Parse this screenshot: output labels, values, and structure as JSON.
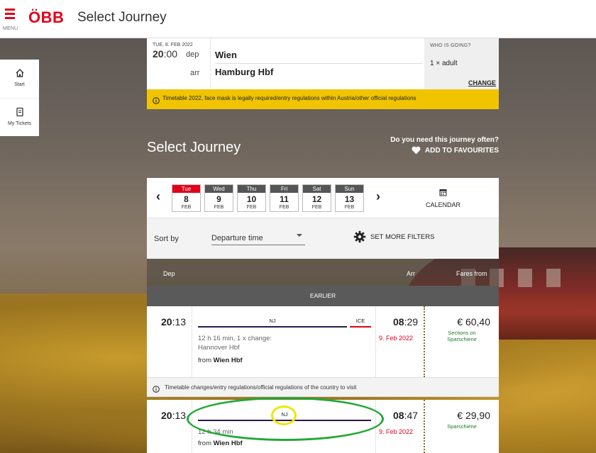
{
  "header": {
    "menu_label": "MENU",
    "logo": "ÖBB",
    "title": "Select Journey"
  },
  "sidenav": {
    "items": [
      {
        "label": "Start",
        "icon": "home-icon"
      },
      {
        "label": "My Tickets",
        "icon": "ticket-icon"
      }
    ]
  },
  "summary": {
    "date": "TUE, 8. FEB 2022",
    "time_hours": "20",
    "time_minutes": ":00",
    "dep_label": "dep",
    "arr_label": "arr",
    "from": "Wien",
    "to": "Hamburg Hbf",
    "who_label": "WHO IS GOING?",
    "who_value": "1 × adult",
    "change_label": "CHANGE"
  },
  "notice_top": "Timetable 2022, face mask is legally required/entry regulations within Austria/other official regulations",
  "page_heading": "Select Journey",
  "favourites": {
    "question": "Do you need this journey often?",
    "action": "ADD TO FAVOURITES"
  },
  "datebar": {
    "prev": "‹",
    "next": "›",
    "days": [
      {
        "name": "Tue",
        "day": "8",
        "month": "FEB",
        "selected": true
      },
      {
        "name": "Wed",
        "day": "9",
        "month": "FEB",
        "selected": false
      },
      {
        "name": "Thu",
        "day": "10",
        "month": "FEB",
        "selected": false
      },
      {
        "name": "Fri",
        "day": "11",
        "month": "FEB",
        "selected": false
      },
      {
        "name": "Sat",
        "day": "12",
        "month": "FEB",
        "selected": false
      },
      {
        "name": "Sun",
        "day": "13",
        "month": "FEB",
        "selected": false
      }
    ],
    "calendar_label": "CALENDAR"
  },
  "sort": {
    "label": "Sort by",
    "value": "Departure time",
    "filters_label": "SET MORE FILTERS"
  },
  "results": {
    "col_dep": "Dep",
    "col_arr": "Arr",
    "col_fares": "Fares from",
    "earlier_label": "EARLIER",
    "connections": [
      {
        "dep_hours": "20",
        "dep_minutes": ":13",
        "train1": "NJ",
        "train2": "ICE",
        "info_line1": "12 h 16 min, 1 x change:",
        "info_line2": "Hannover Hbf",
        "from_prefix": "from",
        "from_station": "Wien Hbf",
        "arr_hours": "08",
        "arr_minutes": ":29",
        "arr_date": "9. Feb 2022",
        "fare": "€ 60,40",
        "fare_note": "Sections on Sparschiene"
      },
      {
        "dep_hours": "20",
        "dep_minutes": ":13",
        "train1": "NJ",
        "info_line1": "12 h 34 min",
        "from_prefix": "from",
        "from_station": "Wien Hbf",
        "arr_hours": "08",
        "arr_minutes": ":47",
        "arr_date": "9. Feb 2022",
        "fare": "€ 29,90",
        "fare_note": "Sparschiene"
      }
    ],
    "notice_middle": "Timetable changes/entry regulations/official regulations of the country to visit"
  },
  "colors": {
    "brand_red": "#e2001a",
    "notice_yellow": "#f0c400",
    "fare_green": "#1e7a2a",
    "annotation_green": "#22a836",
    "annotation_yellow": "#f2e500"
  }
}
